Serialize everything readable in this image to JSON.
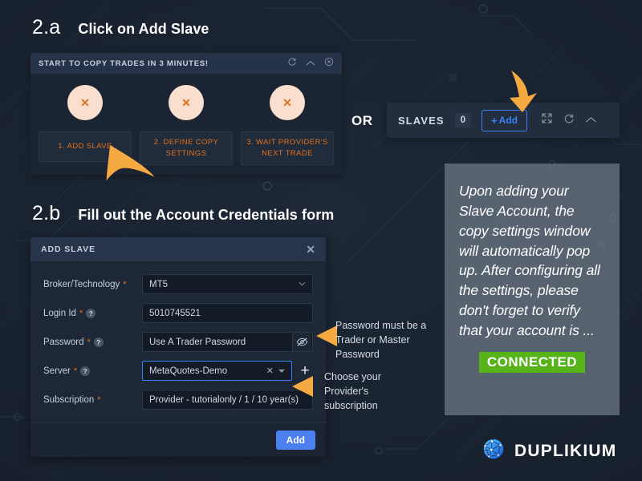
{
  "theme": {
    "background": "#1d2735",
    "panel_bg": "#1b2433",
    "panel_header_bg": "#263247",
    "accent_orange": "#e2711d",
    "accent_blue": "#3b82f6",
    "primary_button_blue": "#4c7ff0",
    "connected_green": "#56b319",
    "circle_peach": "#fadfce",
    "arrow_orange": "#f5a941"
  },
  "step_a": {
    "number": "2.a",
    "title": "Click on Add Slave",
    "panel": {
      "header_title": "START TO COPY TRADES IN 3 MINUTES!",
      "header_icons": [
        {
          "name": "refresh-icon",
          "glyph": "refresh"
        },
        {
          "name": "collapse-icon",
          "glyph": "chevron-up"
        },
        {
          "name": "close-icon",
          "glyph": "circle-x"
        }
      ],
      "steps": [
        {
          "status_icon": "✕",
          "label": "1. ADD SLAVE"
        },
        {
          "status_icon": "✕",
          "label": "2. DEFINE COPY SETTINGS"
        },
        {
          "status_icon": "✕",
          "label": "3. WAIT PROVIDER'S NEXT TRADE"
        }
      ]
    },
    "or_label": "OR",
    "slaves_bar": {
      "label": "SLAVES",
      "count": "0",
      "add_button": {
        "plus": "+",
        "label": "Add"
      },
      "icons": [
        {
          "name": "expand-icon",
          "glyph": "expand"
        },
        {
          "name": "refresh-icon",
          "glyph": "refresh"
        },
        {
          "name": "collapse-icon",
          "glyph": "chevron-up"
        }
      ]
    }
  },
  "step_b": {
    "number": "2.b",
    "title": "Fill out the Account Credentials form",
    "form": {
      "header_title": "ADD SLAVE",
      "close_glyph": "✕",
      "fields": [
        {
          "label": "Broker/Technology",
          "required": "*",
          "has_help": false,
          "value": "MT5",
          "control": "select",
          "focused": false
        },
        {
          "label": "Login Id",
          "required": "*",
          "has_help": true,
          "help_glyph": "?",
          "value": "5010745521",
          "control": "text",
          "focused": false
        },
        {
          "label": "Password",
          "required": "*",
          "has_help": true,
          "help_glyph": "?",
          "value": "Use A Trader Password",
          "control": "password",
          "toggle_icon": "eye-slash-icon",
          "focused": false
        },
        {
          "label": "Server",
          "required": "*",
          "has_help": true,
          "help_glyph": "?",
          "value": "MetaQuotes-Demo",
          "control": "select-clearable",
          "clear_glyph": "✕",
          "add_glyph": "+",
          "focused": true
        },
        {
          "label": "Subscription",
          "required": "*",
          "has_help": false,
          "value": "Provider - tutorialonly / 1 / 10 year(s)",
          "control": "select",
          "focused": false
        }
      ],
      "submit_label": "Add"
    },
    "callouts": [
      {
        "name": "password-callout",
        "text": "Password must be a Trader or Master Password"
      },
      {
        "name": "subscription-callout",
        "text": "Choose your Provider's subscription"
      }
    ]
  },
  "note": {
    "text": "Upon adding your Slave Account, the copy settings window will automatically pop up. After configuring all the settings, please don't forget to verify that your account is ...",
    "badge": "CONNECTED"
  },
  "brand": {
    "name": "DUPLIKIUM",
    "logo_icon": "globe-network-icon"
  }
}
